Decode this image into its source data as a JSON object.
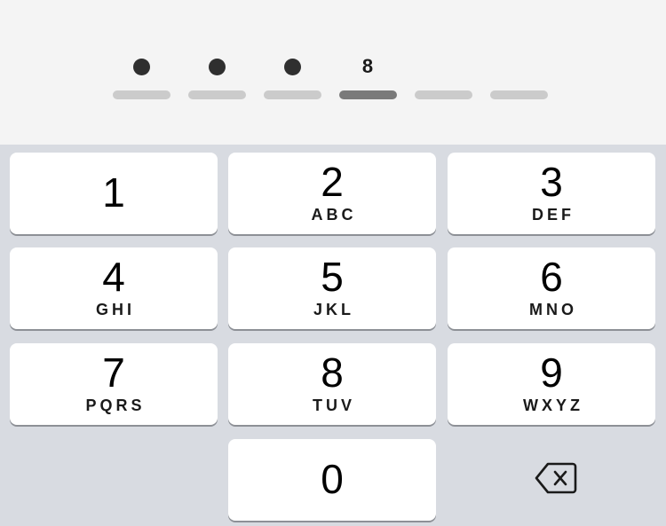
{
  "code_entry": {
    "slots": [
      {
        "state": "filled",
        "char": ""
      },
      {
        "state": "filled",
        "char": ""
      },
      {
        "state": "filled",
        "char": ""
      },
      {
        "state": "active",
        "char": "8"
      },
      {
        "state": "empty",
        "char": ""
      },
      {
        "state": "empty",
        "char": ""
      }
    ]
  },
  "keypad": {
    "keys": [
      {
        "digit": "1",
        "letters": ""
      },
      {
        "digit": "2",
        "letters": "ABC"
      },
      {
        "digit": "3",
        "letters": "DEF"
      },
      {
        "digit": "4",
        "letters": "GHI"
      },
      {
        "digit": "5",
        "letters": "JKL"
      },
      {
        "digit": "6",
        "letters": "MNO"
      },
      {
        "digit": "7",
        "letters": "PQRS"
      },
      {
        "digit": "8",
        "letters": "TUV"
      },
      {
        "digit": "9",
        "letters": "WXYZ"
      },
      {
        "digit": "0",
        "letters": ""
      }
    ],
    "delete_icon": "backspace-icon"
  },
  "colors": {
    "entry_background": "#f4f4f4",
    "keypad_background": "#d8dbe1",
    "key_background": "#ffffff",
    "filled_dot": "#2f2f2f",
    "active_bar": "#7a7a7a",
    "inactive_bar": "#cbcbcb"
  }
}
